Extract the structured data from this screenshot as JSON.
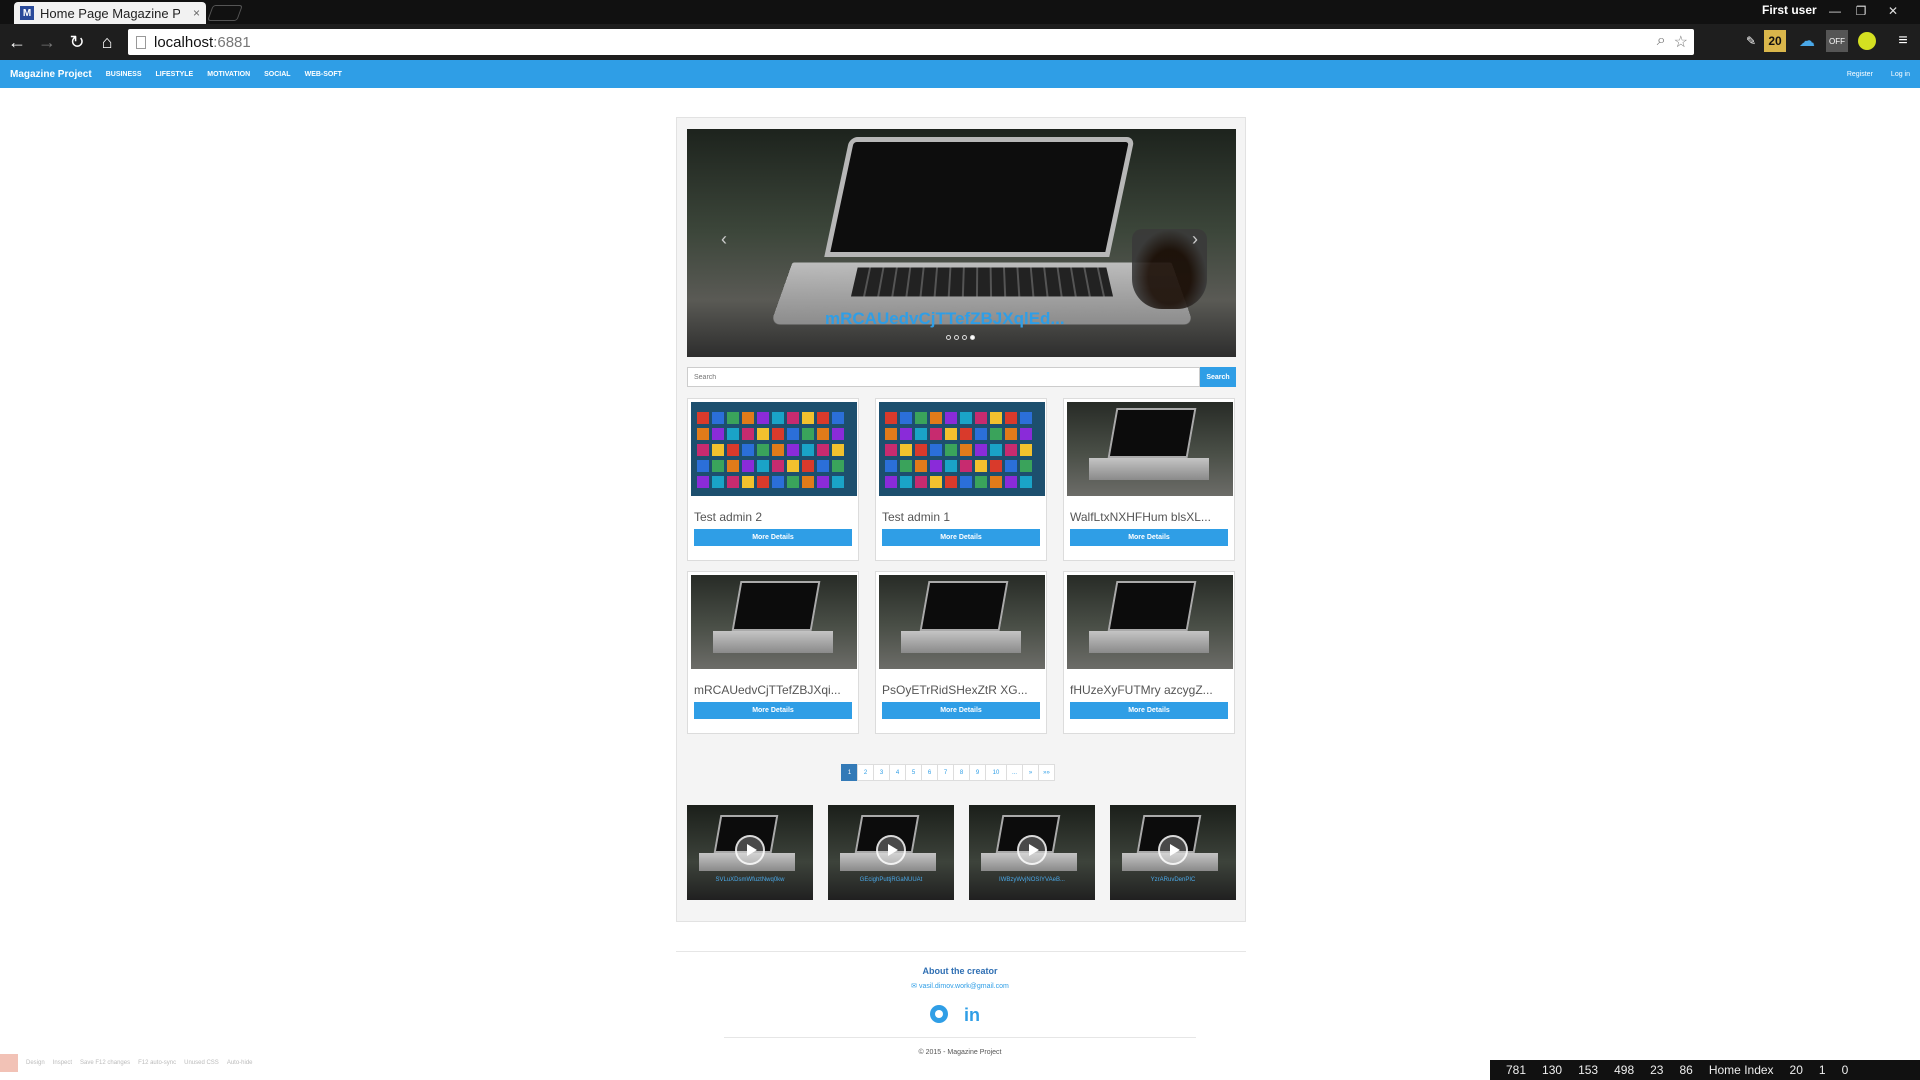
{
  "browser": {
    "tab_title": "Home Page Magazine Pro",
    "tab_close": "×",
    "favicon_letter": "M",
    "user": "First user",
    "url_host": "localhost",
    "url_port": ":6881",
    "extension_badge": "20",
    "extension_off": "OFF"
  },
  "site_nav": {
    "brand": "Magazine Project",
    "links": [
      "BUSINESS",
      "LIFESTYLE",
      "MOTIVATION",
      "SOCIAL",
      "WEB-SOFT"
    ],
    "register": "Register",
    "login": "Log in"
  },
  "carousel": {
    "caption": "mRCAUedvCjTTefZBJXqlEd...",
    "prev": "‹",
    "next": "›",
    "slide_count": 4,
    "active_slide": 4
  },
  "search": {
    "placeholder": "Search",
    "button": "Search"
  },
  "articles": [
    {
      "title": "Test admin 2",
      "button": "More Details",
      "image": "win8-tiles"
    },
    {
      "title": "Test admin 1",
      "button": "More Details",
      "image": "win8-tiles"
    },
    {
      "title": "WalfLtxNXHFHum blsXL...",
      "button": "More Details",
      "image": "laptop"
    },
    {
      "title": "mRCAUedvCjTTefZBJXqi...",
      "button": "More Details",
      "image": "laptop"
    },
    {
      "title": "PsOyETrRidSHexZtR XG...",
      "button": "More Details",
      "image": "laptop"
    },
    {
      "title": "fHUzeXyFUTMry azcygZ...",
      "button": "More Details",
      "image": "laptop"
    }
  ],
  "pagination": [
    "1",
    "2",
    "3",
    "4",
    "5",
    "6",
    "7",
    "8",
    "9",
    "10",
    "...",
    "»",
    "»»"
  ],
  "pagination_active": "1",
  "videos": [
    {
      "title": "SVLuXDsmWfuztNwq0kw"
    },
    {
      "title": "GEcighPuttjRGaNUUAt"
    },
    {
      "title": "IWBzyWvjNOSIYVAeB..."
    },
    {
      "title": "YzrARuvDenPIC"
    }
  ],
  "footer": {
    "about": "About the creator",
    "email": "vasil.dimov.work@gmail.com",
    "linkedin": "in",
    "copyright": "© 2015 - Magazine Project"
  },
  "dev_toolbar": {
    "items": [
      "Design",
      "Inspect",
      "Save F12 changes",
      "F12 auto-sync",
      "Unused CSS",
      "Auto-hide"
    ]
  },
  "glimpse": {
    "values": [
      "781",
      "130",
      "153",
      "498",
      "23",
      "86",
      "Home Index",
      "20",
      "1",
      "0"
    ]
  },
  "colors": {
    "accent": "#2f9ee6",
    "nav_bg": "#2f9ee6",
    "pager_active": "#337ab7"
  }
}
